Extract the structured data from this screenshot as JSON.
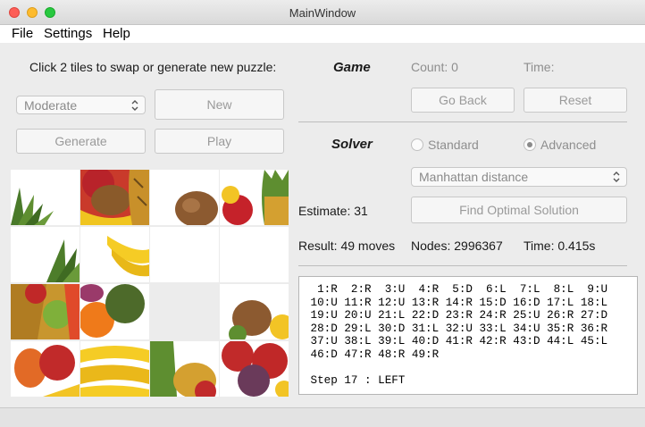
{
  "window": {
    "title": "MainWindow"
  },
  "menu": {
    "file": "File",
    "settings": "Settings",
    "help": "Help"
  },
  "left": {
    "instructions": "Click 2 tiles to swap or generate new puzzle:",
    "difficulty": "Moderate",
    "new_label": "New",
    "generate_label": "Generate",
    "play_label": "Play"
  },
  "game": {
    "heading": "Game",
    "count": "Count: 0",
    "time": "Time:",
    "go_back_label": "Go Back",
    "reset_label": "Reset"
  },
  "solver": {
    "heading": "Solver",
    "standard_label": "Standard",
    "advanced_label": "Advanced",
    "selected_mode": "Advanced",
    "heuristic": "Manhattan distance",
    "estimate": "Estimate: 31",
    "find_label": "Find Optimal Solution",
    "result": "Result: 49 moves",
    "nodes": "Nodes: 2996367",
    "time": "Time: 0.415s"
  },
  "solution_lines": [
    "  1:R  2:R  3:U  4:R  5:D  6:L  7:L  8:L  9:U",
    " 10:U 11:R 12:U 13:R 14:R 15:D 16:D 17:L 18:L",
    " 19:U 20:U 21:L 22:D 23:R 24:R 25:U 26:R 27:D",
    " 28:D 29:L 30:D 31:L 32:U 33:L 34:U 35:R 36:R",
    " 37:U 38:L 39:L 40:D 41:R 42:R 43:D 44:L 45:L",
    " 46:D 47:R 48:R 49:R",
    "",
    " Step 17 : LEFT"
  ]
}
